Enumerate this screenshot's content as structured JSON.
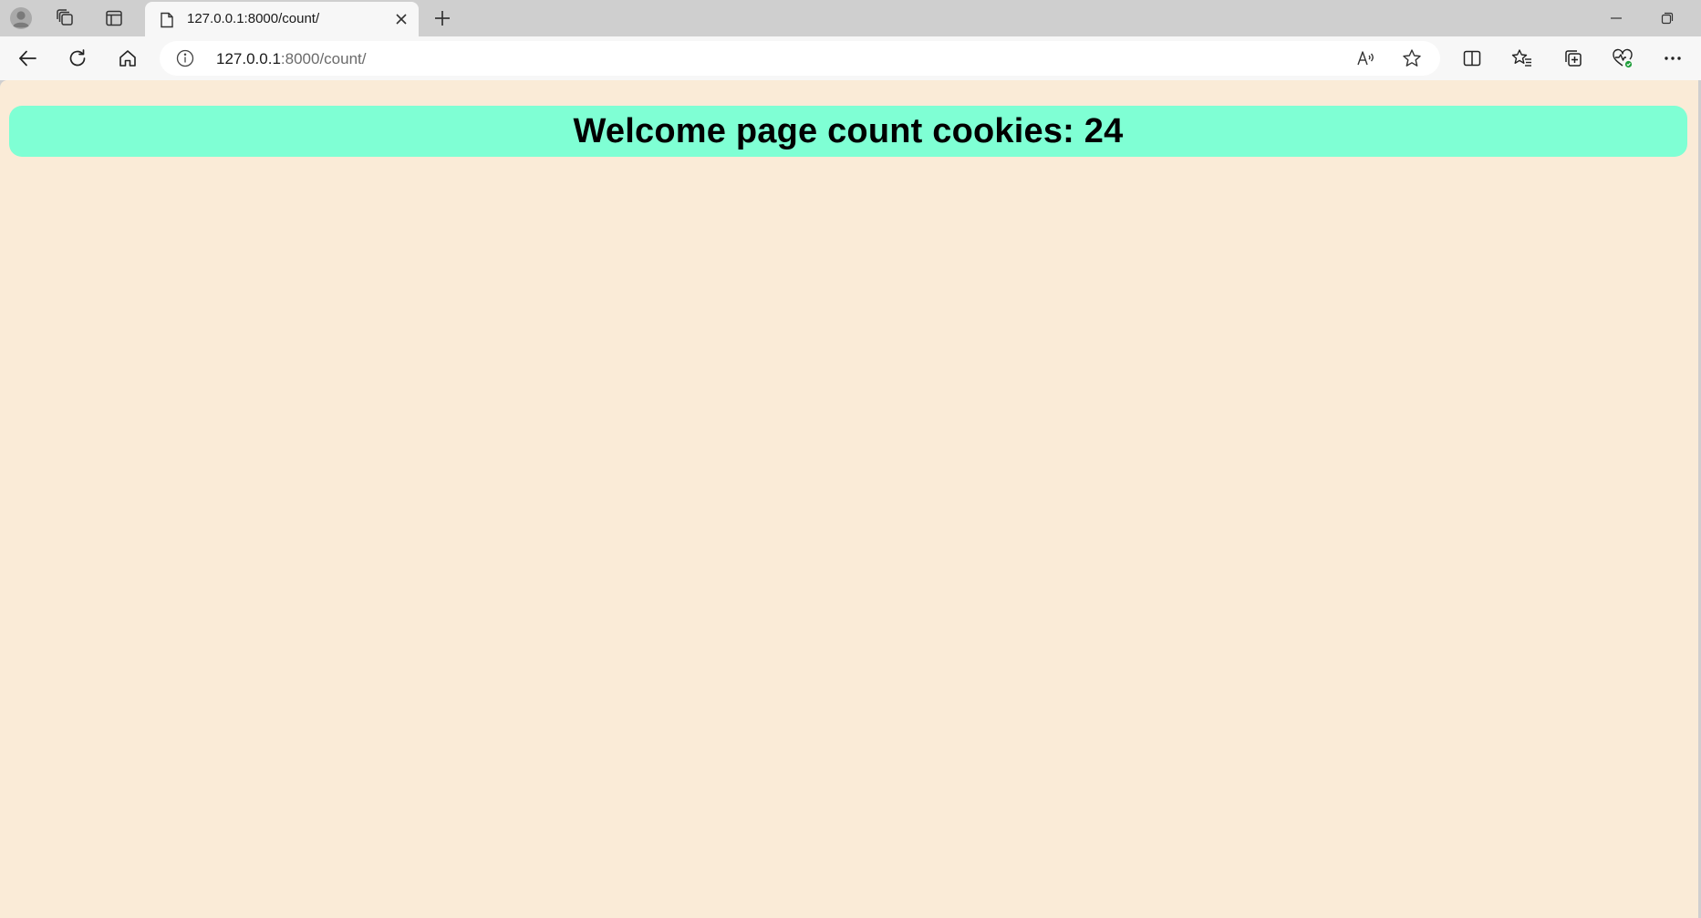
{
  "browser": {
    "tab": {
      "title": "127.0.0.1:8000/count/",
      "favicon": "page-icon"
    },
    "address": {
      "host": "127.0.0.1",
      "path": ":8000/count/"
    },
    "strip_icons": [
      "profile-icon",
      "workspaces-icon",
      "vertical-tabs-icon",
      "new-tab-icon"
    ],
    "window_controls": [
      "minimize-icon",
      "restore-icon"
    ],
    "toolbar_icons": [
      "back-icon",
      "refresh-icon",
      "home-icon"
    ],
    "address_icons": [
      "site-info-icon",
      "read-aloud-icon",
      "favorite-star-icon"
    ],
    "right_icons": [
      "split-screen-icon",
      "favorites-icon",
      "collections-icon",
      "browser-essentials-icon",
      "more-icon"
    ]
  },
  "page": {
    "heading": "Welcome page count cookies: 24",
    "colors": {
      "background": "#faebd7",
      "banner": "#7fffd4"
    }
  }
}
